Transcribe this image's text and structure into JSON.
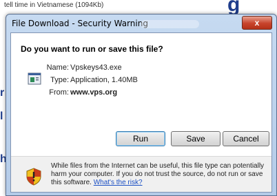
{
  "background": {
    "top_text": "tell time in Vietnamese (1094Kb)",
    "right_word": "g",
    "edge_chars": [
      "r",
      "l",
      "h"
    ]
  },
  "dialog": {
    "title": "File Download - Security Warning",
    "close_label": "x",
    "question": "Do you want to run or save this file?",
    "file": {
      "name_label": "Name:",
      "name_value": "Vpskeys43.exe",
      "type_label": "Type:",
      "type_value": "Application, 1.40MB",
      "from_label": "From:",
      "from_value": "www.vps.org",
      "icon": "application-file-icon"
    },
    "buttons": {
      "run": "Run",
      "save": "Save",
      "cancel": "Cancel"
    },
    "warning": {
      "icon": "security-shield-icon",
      "text": "While files from the Internet can be useful, this file type can potentially harm your computer. If you do not trust the source, do not run or save this software.",
      "link": "What's the risk?"
    }
  },
  "colors": {
    "titlebar": "#c6daf1",
    "close_button": "#c7432b",
    "link": "#1a4fc4",
    "shield_yellow": "#f2c01e",
    "shield_red": "#c93b1c"
  }
}
